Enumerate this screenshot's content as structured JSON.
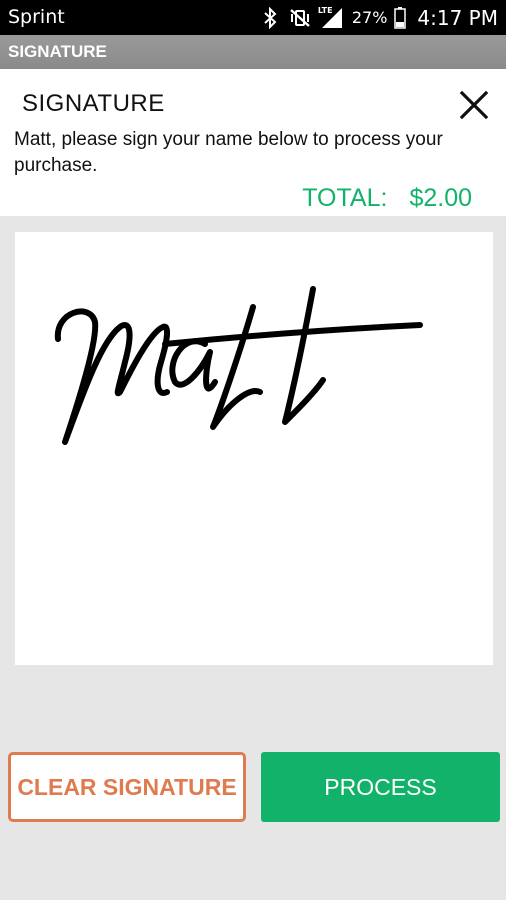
{
  "status_bar": {
    "carrier": "Sprint",
    "network_badge": "LTE",
    "battery_percent": "27%",
    "time": "4:17 PM",
    "icons": [
      "bluetooth-icon",
      "vibrate-mute-icon",
      "lte-signal-icon",
      "battery-icon"
    ]
  },
  "app_bar": {
    "title": "SIGNATURE"
  },
  "header": {
    "title": "SIGNATURE",
    "instructions": "Matt, please sign your name below to process your purchase.",
    "total_label": "TOTAL:",
    "total_value": "$2.00"
  },
  "signature_pad": {
    "signed_name": "Matt"
  },
  "buttons": {
    "clear_label": "CLEAR SIGNATURE",
    "process_label": "PROCESS"
  },
  "colors": {
    "accent_green": "#12b26a",
    "clear_orange": "#e07a4f",
    "title_bar_gray": "#8f8f8f"
  }
}
